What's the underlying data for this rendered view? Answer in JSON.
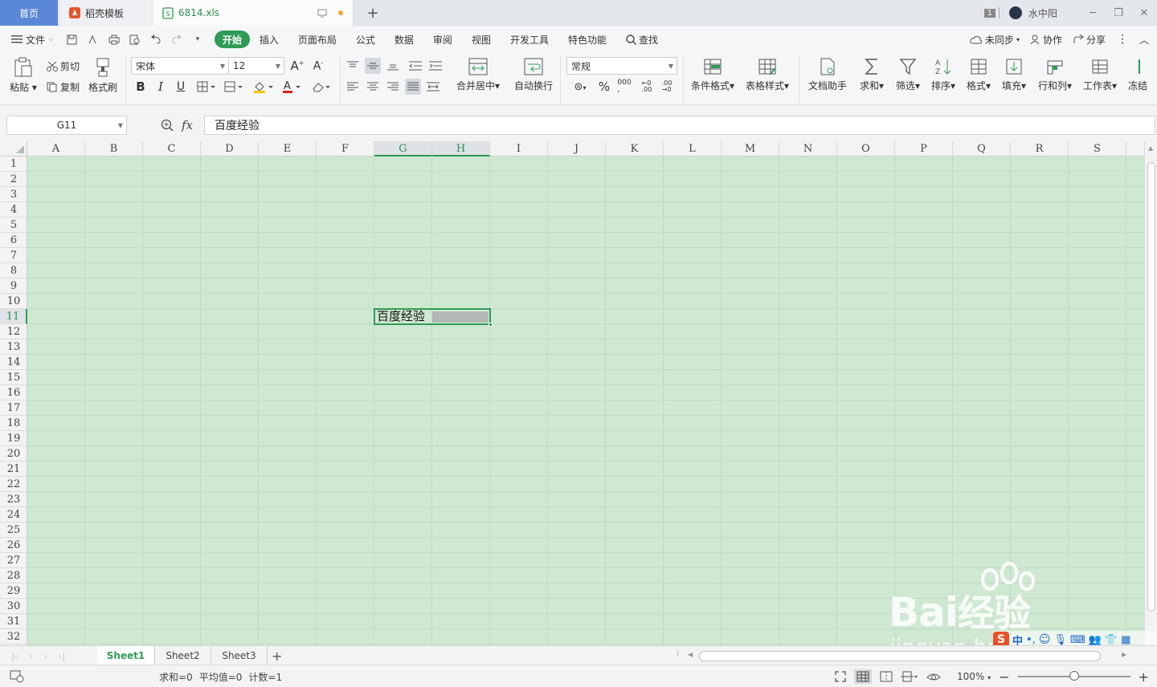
{
  "tabbar": {
    "home": "首页",
    "template": "稻壳模板",
    "file": "6814.xls",
    "badge": "1",
    "user": "水中阳"
  },
  "menu": {
    "file": "文件",
    "items": [
      "开始",
      "插入",
      "页面布局",
      "公式",
      "数据",
      "审阅",
      "视图",
      "开发工具",
      "特色功能"
    ],
    "search": "查找",
    "sync": "未同步",
    "collab": "协作",
    "share": "分享"
  },
  "ribbon": {
    "paste": "粘贴",
    "cut": "剪切",
    "copy": "复制",
    "format_painter": "格式刷",
    "font_name": "宋体",
    "font_size": "12",
    "merge_center": "合并居中",
    "wrap_text": "自动换行",
    "number_format": "常规",
    "cond_format": "条件格式",
    "table_style": "表格样式",
    "doc_assistant": "文档助手",
    "sum": "求和",
    "filter": "筛选",
    "sort": "排序",
    "format": "格式",
    "fill": "填充",
    "row_col": "行和列",
    "worksheet": "工作表",
    "freeze": "冻结"
  },
  "formula_bar": {
    "cell_ref": "G11",
    "fx": "fx",
    "content": "百度经验"
  },
  "grid": {
    "columns": [
      "A",
      "B",
      "C",
      "D",
      "E",
      "F",
      "G",
      "H",
      "I",
      "J",
      "K",
      "L",
      "M",
      "N",
      "O",
      "P",
      "Q",
      "R",
      "S"
    ],
    "rows": [
      "1",
      "2",
      "3",
      "4",
      "5",
      "6",
      "7",
      "8",
      "9",
      "10",
      "11",
      "12",
      "13",
      "14",
      "15",
      "16",
      "17",
      "18",
      "19",
      "20",
      "21",
      "22",
      "23",
      "24",
      "25",
      "26",
      "27",
      "28",
      "29",
      "30",
      "31",
      "32"
    ],
    "selected_columns": [
      "G",
      "H"
    ],
    "selected_row": "11",
    "cell_text": "百度经验",
    "fill_color": "#cfe8d2"
  },
  "sheets": {
    "tabs": [
      "Sheet1",
      "Sheet2",
      "Sheet3"
    ],
    "active": "Sheet1"
  },
  "status": {
    "sum": "求和=0",
    "avg": "平均值=0",
    "count": "计数=1",
    "zoom": "100%"
  },
  "watermark": {
    "brand": "Bai",
    "brand_cn": "经验",
    "url": "jingyan.baidu.com"
  },
  "colors": {
    "accent": "#2f9c55",
    "home_tab": "#5b88d6",
    "sheet_fill": "#cfe8d2"
  }
}
